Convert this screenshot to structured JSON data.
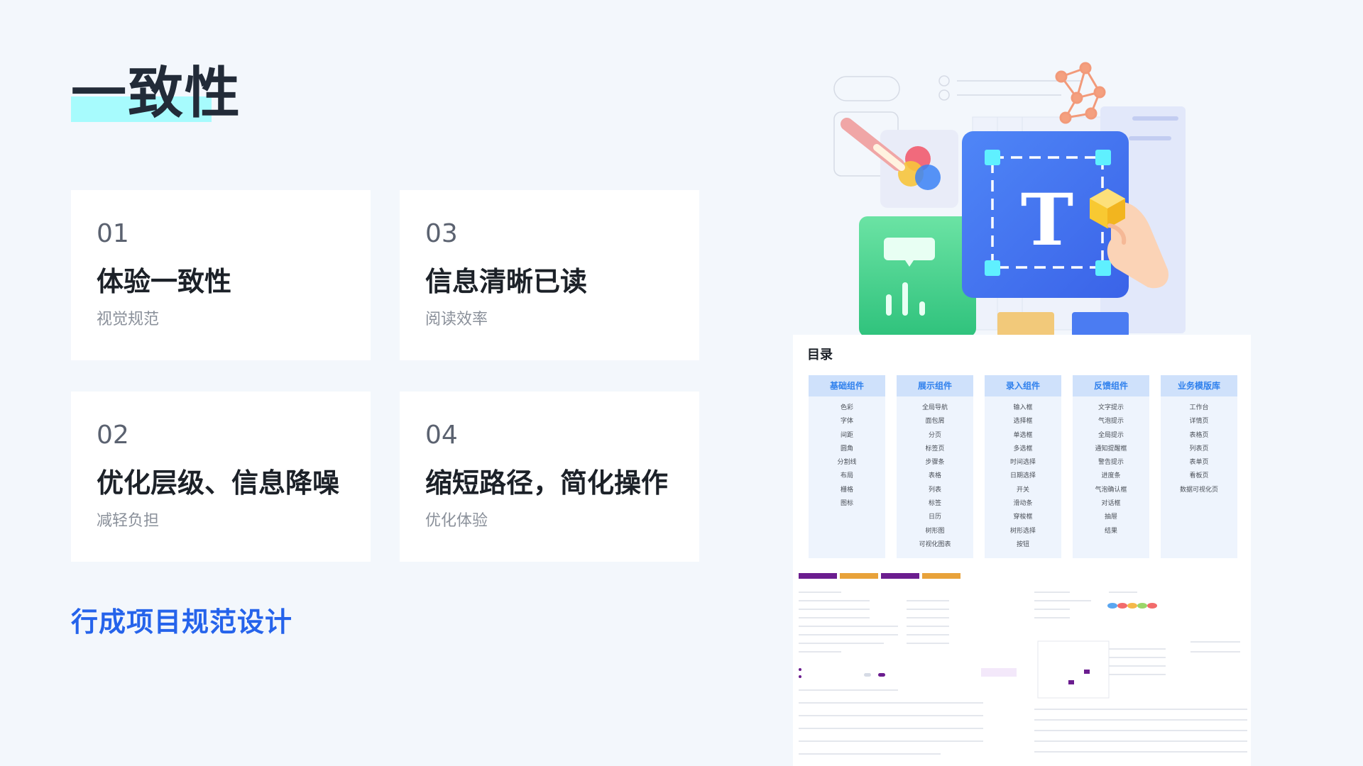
{
  "title": "一致性",
  "cards": [
    {
      "num": "01",
      "title": "体验一致性",
      "sub": "视觉规范"
    },
    {
      "num": "03",
      "title": "信息清晰已读",
      "sub": "阅读效率"
    },
    {
      "num": "02",
      "title": "优化层级、信息降噪",
      "sub": "减轻负担"
    },
    {
      "num": "04",
      "title": "缩短路径，简化操作",
      "sub": "优化体验"
    }
  ],
  "footer": {
    "title": "行成项目规范设计"
  },
  "illustration": {
    "letter": "T"
  },
  "catalog": {
    "title": "目录",
    "columns": [
      {
        "head": "基础组件",
        "items": [
          "色彩",
          "字体",
          "间距",
          "圆角",
          "分割线",
          "布局",
          "栅格",
          "图标"
        ]
      },
      {
        "head": "展示组件",
        "items": [
          "全局导航",
          "面包屑",
          "分页",
          "标签页",
          "步骤条",
          "表格",
          "列表",
          "标签",
          "日历",
          "树形图",
          "可视化图表"
        ]
      },
      {
        "head": "录入组件",
        "items": [
          "输入框",
          "选择框",
          "单选框",
          "多选框",
          "时间选择",
          "日期选择",
          "开关",
          "滑动条",
          "穿梭框",
          "树形选择",
          "按钮"
        ]
      },
      {
        "head": "反馈组件",
        "items": [
          "文字提示",
          "气泡提示",
          "全局提示",
          "通知提醒框",
          "警告提示",
          "进度条",
          "气泡确认框",
          "对话框",
          "抽屉",
          "结果"
        ]
      },
      {
        "head": "业务模版库",
        "items": [
          "工作台",
          "详情页",
          "表格页",
          "列表页",
          "表单页",
          "看板页",
          "数据可视化页"
        ]
      }
    ]
  },
  "colors": {
    "accent": "#2563eb",
    "highlight": "#a7fbfd",
    "catalog_head": "#cfe1fb",
    "catalog_text": "#2f80ed"
  }
}
